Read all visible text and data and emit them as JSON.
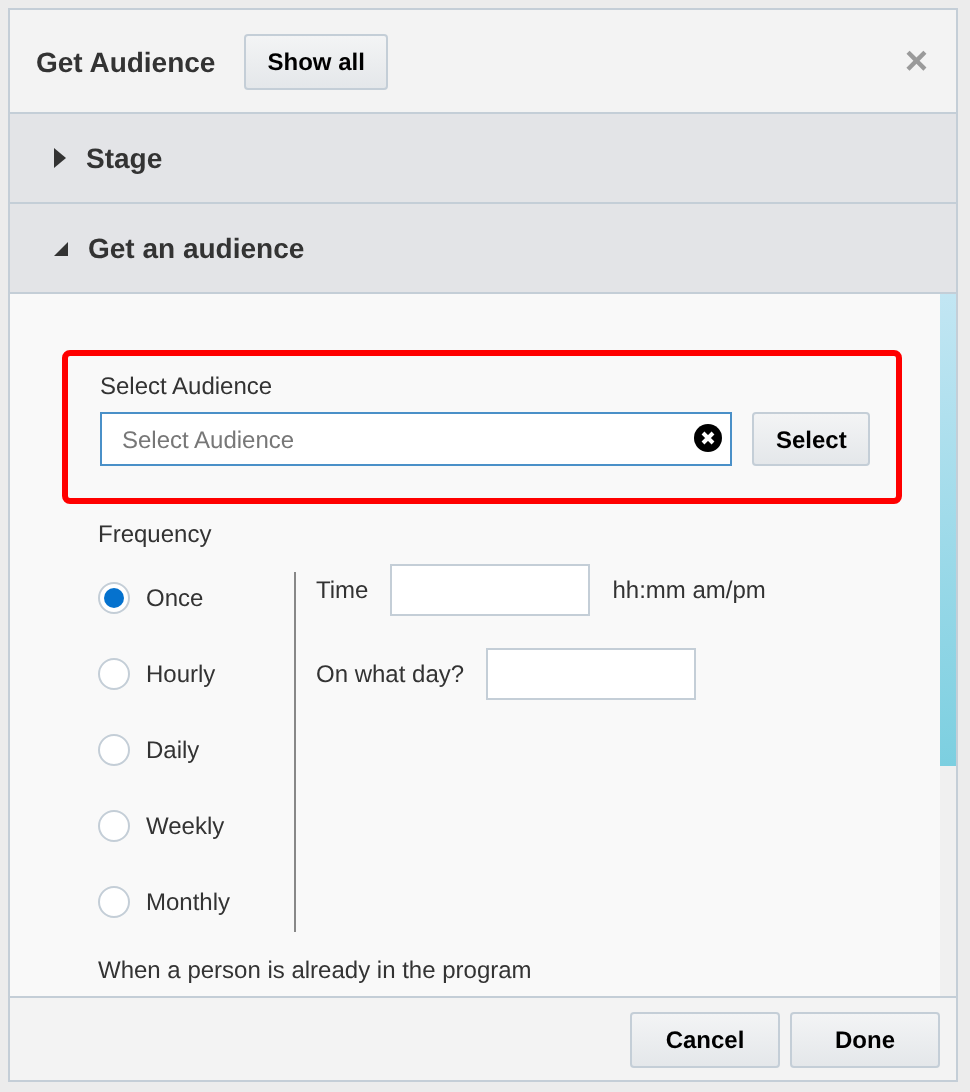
{
  "dialog": {
    "title": "Get Audience",
    "header_button": "Show all",
    "close": "×"
  },
  "sections": [
    {
      "label": "Stage",
      "expanded": false
    },
    {
      "label": "Get an audience",
      "expanded": true
    }
  ],
  "audience": {
    "label": "Select Audience",
    "placeholder": "Select Audience",
    "button": "Select",
    "highlighted": true
  },
  "frequency": {
    "label": "Frequency",
    "options": [
      {
        "label": "Once",
        "selected": true
      },
      {
        "label": "Hourly",
        "selected": false
      },
      {
        "label": "Daily",
        "selected": false
      },
      {
        "label": "Weekly",
        "selected": false
      },
      {
        "label": "Monthly",
        "selected": false
      }
    ],
    "time_label": "Time",
    "time_hint": "hh:mm am/pm",
    "day_label": "On what day?"
  },
  "next_label": "When a person is already in the program",
  "buttons": [
    {
      "label": "Cancel"
    },
    {
      "label": "Done"
    }
  ]
}
